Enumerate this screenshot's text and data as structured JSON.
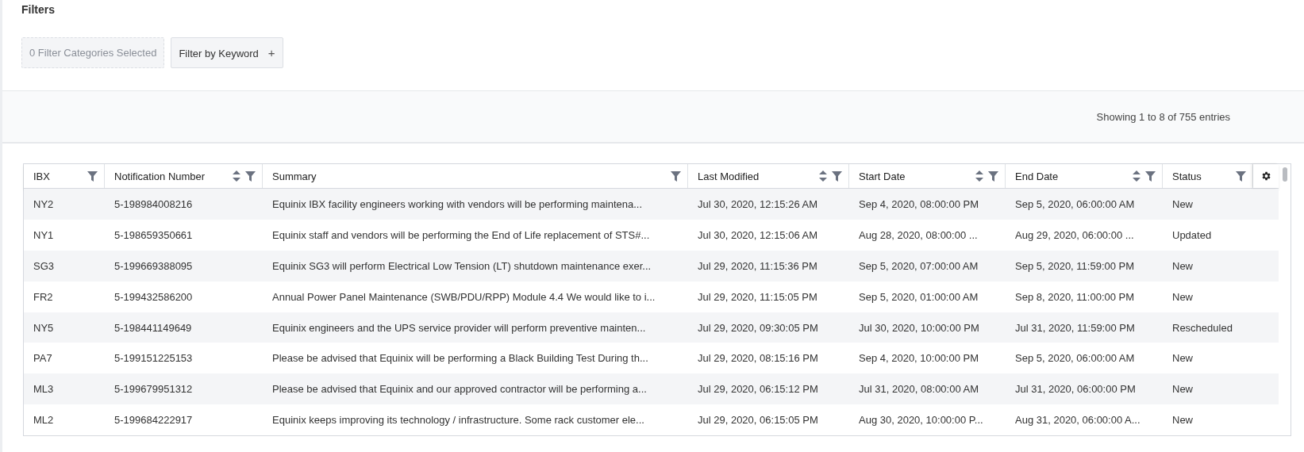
{
  "filters": {
    "title": "Filters",
    "categories_button": "0 Filter Categories Selected",
    "keyword_button": {
      "label": "Filter by Keyword",
      "icon": "+"
    }
  },
  "info": "Showing 1 to 8 of 755 entries",
  "table": {
    "columns": [
      {
        "label": "IBX",
        "sortable": false,
        "filterable": true
      },
      {
        "label": "Notification Number",
        "sortable": true,
        "filterable": true
      },
      {
        "label": "Summary",
        "sortable": false,
        "filterable": true
      },
      {
        "label": "Last Modified",
        "sortable": true,
        "filterable": true
      },
      {
        "label": "Start Date",
        "sortable": true,
        "filterable": true
      },
      {
        "label": "End Date",
        "sortable": true,
        "filterable": true
      },
      {
        "label": "Status",
        "sortable": false,
        "filterable": true
      }
    ],
    "rows": [
      [
        "NY2",
        "5-198984008216",
        "Equinix IBX facility engineers working with vendors will be performing maintena...",
        "Jul 30, 2020, 12:15:26 AM",
        "Sep 4, 2020, 08:00:00 PM",
        "Sep 5, 2020, 06:00:00 AM",
        "New"
      ],
      [
        "NY1",
        "5-198659350661",
        "Equinix staff and vendors will be performing the End of Life replacement of STS#...",
        "Jul 30, 2020, 12:15:06 AM",
        "Aug 28, 2020, 08:00:00 ...",
        "Aug 29, 2020, 06:00:00 ...",
        "Updated"
      ],
      [
        "SG3",
        "5-199669388095",
        "Equinix SG3 will perform Electrical Low Tension (LT) shutdown maintenance exer...",
        "Jul 29, 2020, 11:15:36 PM",
        "Sep 5, 2020, 07:00:00 AM",
        "Sep 5, 2020, 11:59:00 PM",
        "New"
      ],
      [
        "FR2",
        "5-199432586200",
        "Annual Power Panel Maintenance (SWB/PDU/RPP) Module 4.4 We would like to i...",
        "Jul 29, 2020, 11:15:05 PM",
        "Sep 5, 2020, 01:00:00 AM",
        "Sep 8, 2020, 11:00:00 PM",
        "New"
      ],
      [
        "NY5",
        "5-198441149649",
        "Equinix engineers and the UPS service provider will perform preventive mainten...",
        "Jul 29, 2020, 09:30:05 PM",
        "Jul 30, 2020, 10:00:00 PM",
        "Jul 31, 2020, 11:59:00 PM",
        "Rescheduled"
      ],
      [
        "PA7",
        "5-199151225153",
        "Please be advised that Equinix will be performing a Black Building Test During th...",
        "Jul 29, 2020, 08:15:16 PM",
        "Sep 4, 2020, 10:00:00 PM",
        "Sep 5, 2020, 06:00:00 AM",
        "New"
      ],
      [
        "ML3",
        "5-199679951312",
        "Please be advised that Equinix and our approved contractor will be performing a...",
        "Jul 29, 2020, 06:15:12 PM",
        "Jul 31, 2020, 08:00:00 AM",
        "Jul 31, 2020, 06:00:00 PM",
        "New"
      ],
      [
        "ML2",
        "5-199684222917",
        "Equinix keeps improving its technology / infrastructure. Some rack customer ele...",
        "Jul 29, 2020, 06:15:05 PM",
        "Aug 30, 2020, 10:00:00 P...",
        "Aug 31, 2020, 06:00:00 A...",
        "New"
      ]
    ]
  }
}
